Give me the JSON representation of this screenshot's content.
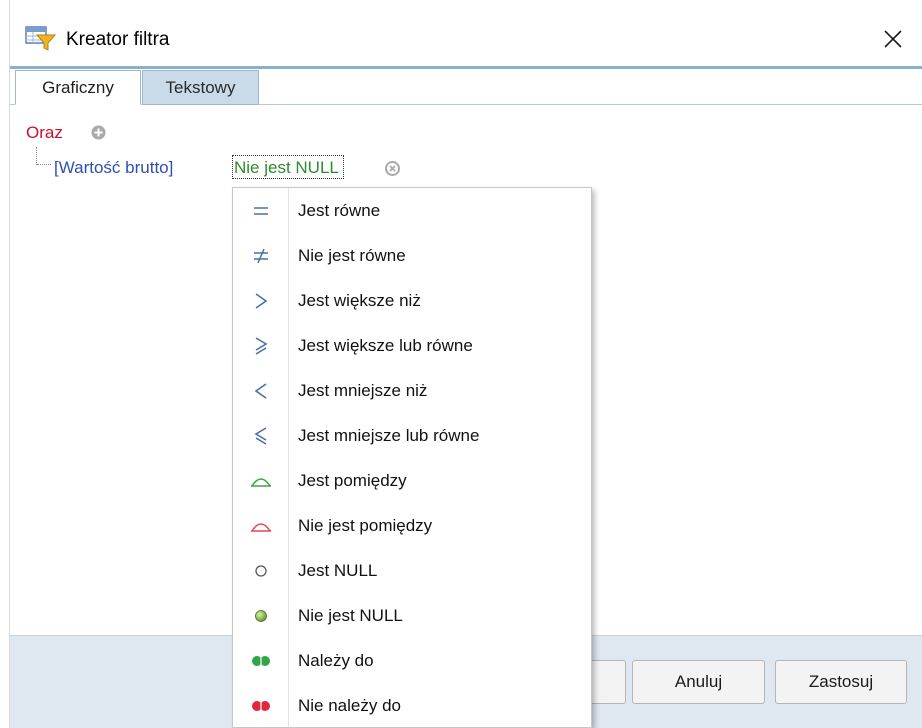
{
  "window": {
    "title": "Kreator filtra",
    "close_icon": "close-icon"
  },
  "tabs": [
    {
      "label": "Graficzny",
      "active": true
    },
    {
      "label": "Tekstowy",
      "active": false
    }
  ],
  "filter_tree": {
    "group_label": "Oraz",
    "add_icon": "plus-circle-icon",
    "condition": {
      "field": "[Wartość brutto]",
      "operator": "Nie jest NULL",
      "remove_icon": "x-circle-icon"
    }
  },
  "operator_menu": {
    "items": [
      {
        "label": "Jest równe",
        "icon": "equals-icon"
      },
      {
        "label": "Nie jest równe",
        "icon": "not-equal-icon"
      },
      {
        "label": "Jest większe niż",
        "icon": "greater-than-icon"
      },
      {
        "label": "Jest większe lub równe",
        "icon": "greater-equal-icon"
      },
      {
        "label": "Jest mniejsze niż",
        "icon": "less-than-icon"
      },
      {
        "label": "Jest mniejsze lub równe",
        "icon": "less-equal-icon"
      },
      {
        "label": "Jest pomiędzy",
        "icon": "between-icon"
      },
      {
        "label": "Nie jest pomiędzy",
        "icon": "not-between-icon"
      },
      {
        "label": "Jest NULL",
        "icon": "null-icon"
      },
      {
        "label": "Nie jest NULL",
        "icon": "not-null-icon"
      },
      {
        "label": "Należy do",
        "icon": "in-icon"
      },
      {
        "label": "Nie należy do",
        "icon": "not-in-icon"
      }
    ]
  },
  "buttons": {
    "ok_label": "",
    "cancel_label": "Anuluj",
    "apply_label": "Zastosuj"
  },
  "colors": {
    "group_red": "#c8102e",
    "field_blue": "#2e4fb3",
    "operator_green": "#2e8b2e",
    "tab_inactive_bg": "#c9dbe9",
    "bottom_bar_bg": "#dfe7f0"
  }
}
